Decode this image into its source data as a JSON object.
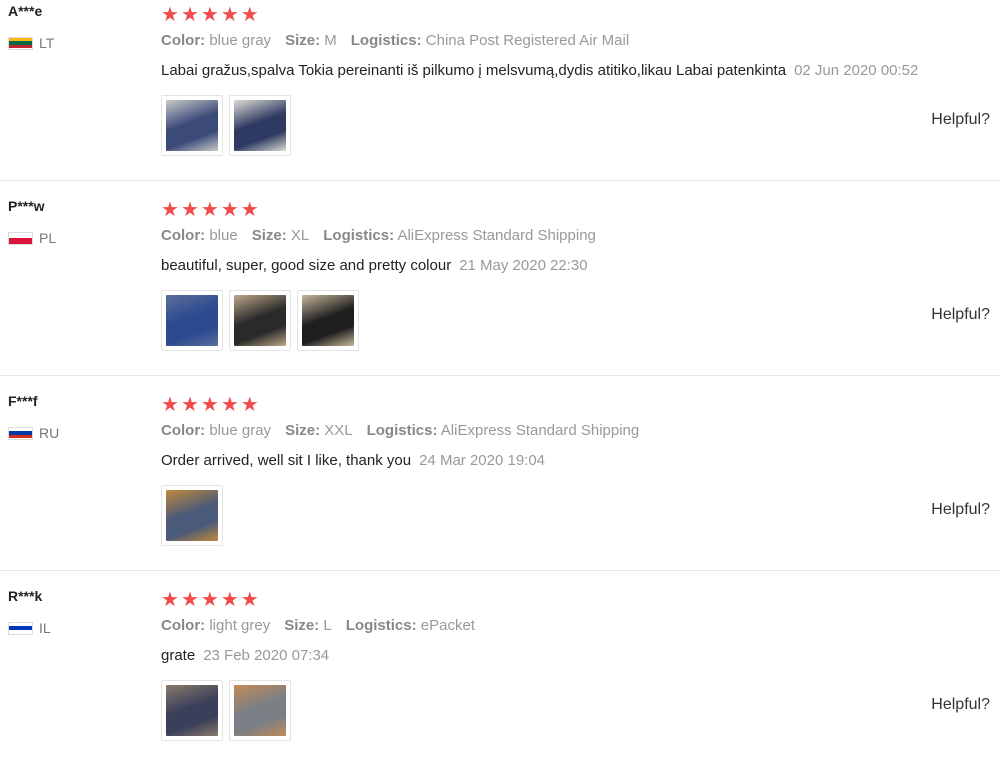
{
  "reviews": [
    {
      "user": "A***e",
      "country": "LT",
      "flag": [
        "#fdb913",
        "#006a44",
        "#c1272d"
      ],
      "rating": 5,
      "attributes": [
        {
          "key": "Color:",
          "value": "blue gray"
        },
        {
          "key": "Size:",
          "value": "M"
        },
        {
          "key": "Logistics:",
          "value": "China Post Registered Air Mail"
        }
      ],
      "text": "Labai gražus,spalva Tokia pereinanti iš pilkumo į melsvumą,dydis atitiko,likau Labai patenkinta",
      "date": "02 Jun 2020 00:52",
      "photos": [
        {
          "colors": [
            "#3c4a7a",
            "#c9c9c9"
          ]
        },
        {
          "colors": [
            "#2f3a62",
            "#dcdcd4"
          ]
        }
      ],
      "helpful": "Helpful?"
    },
    {
      "user": "P***w",
      "country": "PL",
      "flag": [
        "#ffffff",
        "#dc143c"
      ],
      "rating": 5,
      "attributes": [
        {
          "key": "Color:",
          "value": "blue"
        },
        {
          "key": "Size:",
          "value": "XL"
        },
        {
          "key": "Logistics:",
          "value": "AliExpress Standard Shipping"
        }
      ],
      "text": "beautiful, super, good size and pretty colour",
      "date": "21 May 2020 22:30",
      "photos": [
        {
          "colors": [
            "#2c4a90",
            "#5b6e9a"
          ]
        },
        {
          "colors": [
            "#2a2a2a",
            "#bda88a"
          ]
        },
        {
          "colors": [
            "#1f1f1f",
            "#c8b79c"
          ]
        }
      ],
      "helpful": "Helpful?"
    },
    {
      "user": "F***f",
      "country": "RU",
      "flag": [
        "#ffffff",
        "#0039a6",
        "#d52b1e"
      ],
      "rating": 5,
      "attributes": [
        {
          "key": "Color:",
          "value": "blue gray"
        },
        {
          "key": "Size:",
          "value": "XXL"
        },
        {
          "key": "Logistics:",
          "value": "AliExpress Standard Shipping"
        }
      ],
      "text": "Order arrived, well sit I like, thank you",
      "date": "24 Mar 2020 19:04",
      "photos": [
        {
          "colors": [
            "#4a5a78",
            "#c28a3c"
          ]
        }
      ],
      "helpful": "Helpful?"
    },
    {
      "user": "R***k",
      "country": "IL",
      "flag": [
        "#ffffff",
        "#0038b8",
        "#ffffff"
      ],
      "rating": 5,
      "attributes": [
        {
          "key": "Color:",
          "value": "light grey"
        },
        {
          "key": "Size:",
          "value": "L"
        },
        {
          "key": "Logistics:",
          "value": "ePacket"
        }
      ],
      "text": "grate",
      "date": "23 Feb 2020 07:34",
      "photos": [
        {
          "colors": [
            "#3a3f5a",
            "#8a7a6a"
          ]
        },
        {
          "colors": [
            "#7a7f86",
            "#c28a5a"
          ]
        }
      ],
      "helpful": "Helpful?"
    }
  ]
}
